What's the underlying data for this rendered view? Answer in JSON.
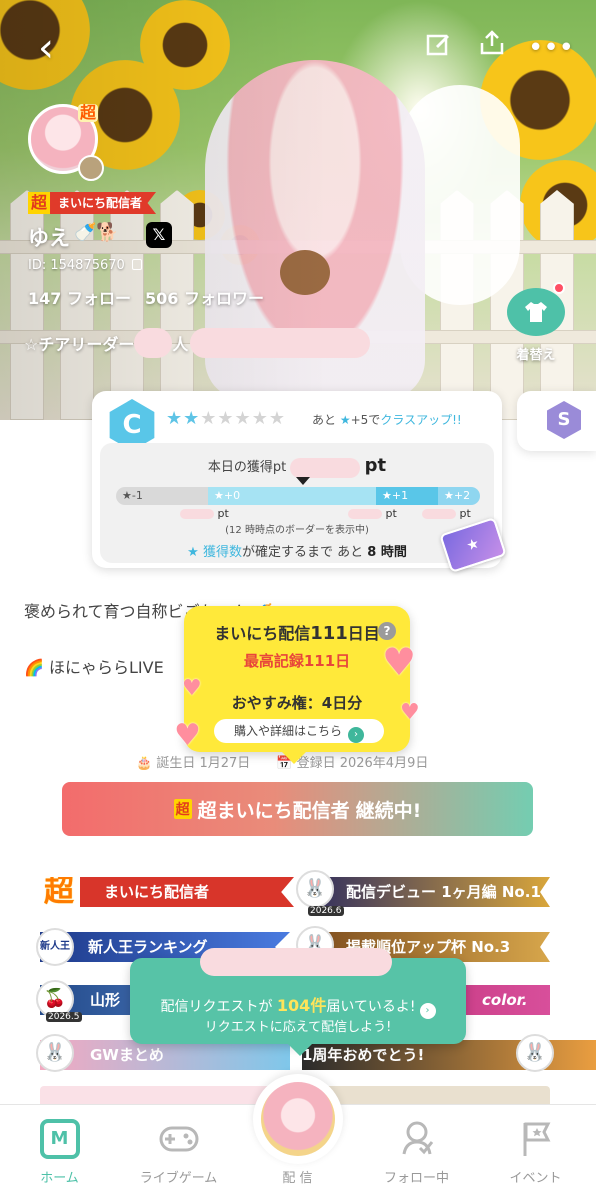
{
  "header": {
    "back_icon": "chevron-left-icon",
    "edit_icon": "edit-icon",
    "share_icon": "share-icon",
    "more_icon": "more-icon"
  },
  "profile": {
    "chou_badge": "超",
    "tag_chou": "超",
    "tag_text": "まいにち配信者",
    "name": "ゆえ",
    "name_deco": "🍼🐕",
    "x_label": "𝕏",
    "id_label": "ID: 154875670",
    "follow_label": "147 フォロー",
    "follower_label": "506 フォロワー",
    "cheer_prefix": "☆チアリーダー",
    "cheer_suffix": "人",
    "dressup_label": "着替え"
  },
  "class_card": {
    "badge": "C",
    "stars_on": "★★",
    "stars_off": "★★★★★",
    "classup_prefix": "あと",
    "classup_star": "★",
    "classup_count": "+5で",
    "classup_link": "クラスアップ!!",
    "today_label": "本日の獲得pt",
    "pt_unit": "pt",
    "segments": [
      "★-1",
      "★+0",
      "★+1",
      "★+2"
    ],
    "pt_labels": [
      "pt",
      "pt",
      "pt"
    ],
    "border_note": "(12 時時点のボーダーを表示中)",
    "confirm_prefix": "★",
    "confirm_blue": "獲得数",
    "confirm_text": "が確定するまで あと",
    "confirm_hours": "8 時間",
    "next_class_badge": "S"
  },
  "bio": {
    "line1": "褒められて育つ自称ビごちゃん 🍼",
    "line2": "🌈 ほにゃららLIVE",
    "birthday": "🎂 誕生日 1月27日",
    "registered": "📅 登録日 2026年4月9日"
  },
  "streak_popup": {
    "title_prefix": "まいにち配信",
    "days": "111",
    "title_suffix": "日目",
    "help": "?",
    "best_record": "最高記録111日",
    "rest_rights": "おやすみ権：4日分",
    "buy_link": "購入や詳細はこちら",
    "buy_arrow": "›"
  },
  "continue_bar": {
    "chou": "超",
    "main": "超まいにち配信者",
    "suffix": "継続中!"
  },
  "badges": {
    "mainichi_chou": "超",
    "mainichi_text": "まいにち配信者",
    "debut": "配信デビュー 1ヶ月編 No.1",
    "rookie": "新人王ランキング",
    "rookie_icon_text": "新人王",
    "rise": "掲載順位アップ杯 No.3",
    "mountain": "山形",
    "color": "color.",
    "gw": "GWまとめ",
    "anniv": "1周年おめでとう!",
    "year_2026_6": "2026.6",
    "year_2026_5": "2026.5"
  },
  "request_popup": {
    "line1_prefix": "配信リクエストが",
    "count": "104",
    "line1_unit": "件",
    "line1_suffix": "届いているよ!",
    "go": "›",
    "line2": "リクエストに応えて配信しよう!"
  },
  "bottom_nav": {
    "items": [
      {
        "label": "ホーム",
        "icon": "home-icon",
        "active": true
      },
      {
        "label": "ライブゲーム",
        "icon": "gamepad-icon"
      },
      {
        "label": "配 信",
        "icon": "stream-avatar-icon"
      },
      {
        "label": "フォロー中",
        "icon": "follow-icon"
      },
      {
        "label": "イベント",
        "icon": "event-flag-icon"
      }
    ],
    "home_mark": "M",
    "game_glyph": "🎮",
    "follow_glyph": "⚲",
    "event_glyph": "⚑"
  },
  "colors": {
    "accent": "#4ec1a8",
    "class_blue": "#59c6e8",
    "streak_yellow": "#ffe93a",
    "record_red": "#e8463b",
    "mainichi_red": "#d8352a"
  }
}
